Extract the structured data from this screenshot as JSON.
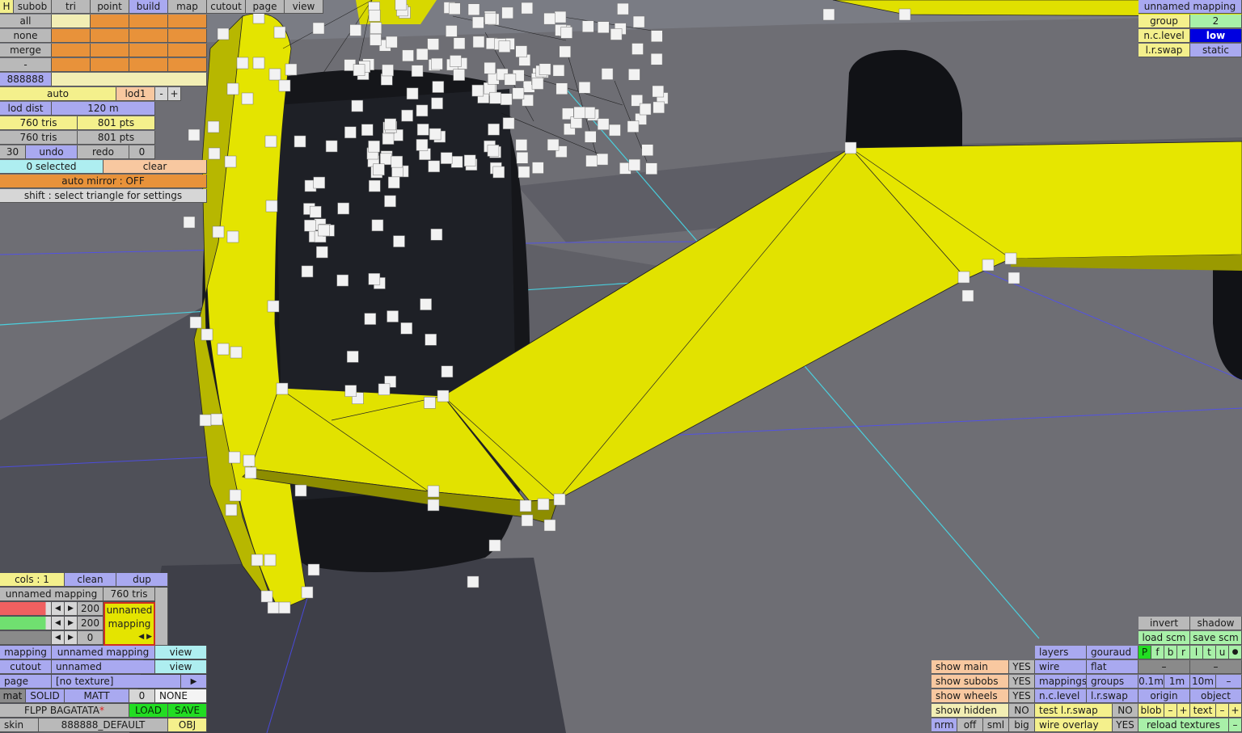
{
  "top_tabs": {
    "h": "H",
    "items": [
      "subob",
      "tri",
      "point",
      "build",
      "map",
      "cutout",
      "page",
      "view"
    ],
    "active": "build"
  },
  "select_rows": [
    "all",
    "none",
    "merge",
    "-"
  ],
  "color_code": "888888",
  "lod": {
    "auto": "auto",
    "level": "lod1",
    "minus": "-",
    "plus": "+",
    "dist_label": "lod dist",
    "dist_value": "120 m"
  },
  "stats": {
    "tris1": "760 tris",
    "pts1": "801 pts",
    "tris2": "760 tris",
    "pts2": "801 pts"
  },
  "undo": {
    "count_left": "30",
    "undo": "undo",
    "redo": "redo",
    "count_right": "0"
  },
  "selection": {
    "selected": "0 selected",
    "clear": "clear",
    "mirror": "auto mirror : OFF",
    "hint": "shift : select triangle for settings"
  },
  "top_right": {
    "mapping_title": "unnamed mapping",
    "group_label": "group",
    "group_value": "2",
    "nc_label": "n.c.level",
    "nc_value": "low",
    "lr_label": "l.r.swap",
    "lr_value": "static"
  },
  "bottom_left": {
    "cols": "cols : 1",
    "clean": "clean",
    "dup": "dup",
    "mapping_name": "unnamed mapping",
    "mapping_tris": "760 tris",
    "val1": "200",
    "val2": "200",
    "val3": "0",
    "preview_line1": "unnamed",
    "preview_line2": "mapping",
    "mapping_label": "mapping",
    "mapping_value": "unnamed mapping",
    "view1": "view",
    "cutout_label": "cutout",
    "cutout_value": "unnamed",
    "view2": "view",
    "page_label": "page",
    "page_value": "[no texture]",
    "page_arrow": "▶",
    "mat_label": "mat",
    "solid": "SOLID",
    "matt": "MATT",
    "mat_num": "0",
    "mat_none": "NONE",
    "file": "FLPP BAGATATA",
    "file_star": "*",
    "load": "LOAD",
    "save": "SAVE",
    "skin_label": "skin",
    "skin_value": "888888_DEFAULT",
    "obj": "OBJ"
  },
  "bottom_mid": {
    "rows": [
      {
        "label": "show main",
        "value": "YES"
      },
      {
        "label": "show subobs",
        "value": "YES"
      },
      {
        "label": "show wheels",
        "value": "YES"
      },
      {
        "label": "show hidden",
        "value": "NO"
      }
    ],
    "nrm": "nrm",
    "off": "off",
    "sml": "sml",
    "big": "big"
  },
  "bottom_right": {
    "layers": "layers",
    "gouraud": "gouraud",
    "wire": "wire",
    "flat": "flat",
    "mappings": "mappings",
    "groups": "groups",
    "nclevel": "n.c.level",
    "lrswap": "l.r.swap",
    "test_lr": "test l.r.swap",
    "test_lr_value": "NO",
    "wire_overlay": "wire overlay",
    "wire_overlay_value": "YES",
    "invert": "invert",
    "shadow": "shadow",
    "load_scm": "load scm",
    "save_scm": "save scm",
    "letters": [
      "P",
      "f",
      "b",
      "r",
      "l",
      "t",
      "u",
      "●"
    ],
    "dash1": "–",
    "dash2": "–",
    "grid": [
      "0.1m",
      "1m",
      "10m",
      "–"
    ],
    "origin": "origin",
    "object": "object",
    "blob": "blob",
    "text": "text",
    "minus": "–",
    "plus": "+",
    "reload": "reload textures",
    "reload_minus": "–"
  },
  "colors": {
    "yellow_mesh": "#e4e400",
    "background": "#6e6e74",
    "tire": "#15161a"
  }
}
